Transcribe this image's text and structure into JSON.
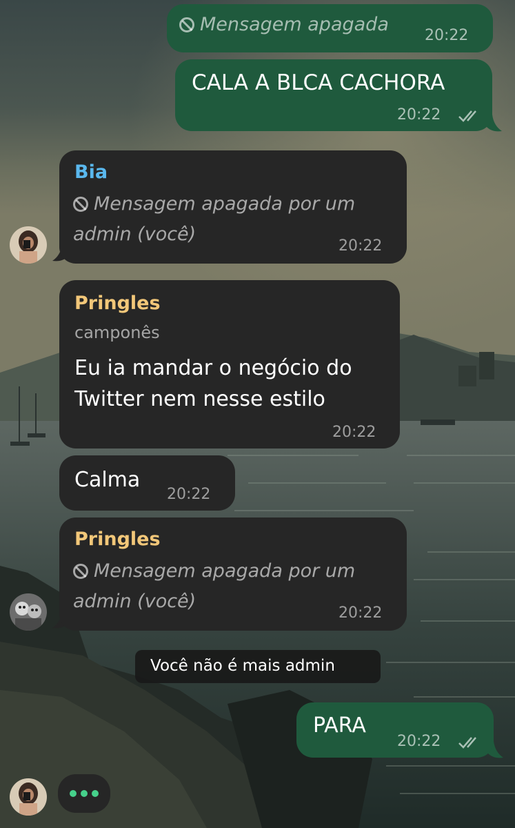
{
  "colors": {
    "outgoing_bubble": "#1f5a3d",
    "incoming_bubble": "#262626",
    "sender_bia": "#5ab8ee",
    "sender_pringles": "#f2c779",
    "typing_dots": "#46d18b"
  },
  "messages": {
    "m1": {
      "deleted_text": "Mensagem apagada",
      "time": "20:22"
    },
    "m2": {
      "text": "CALA A BLCA CACHORA",
      "time": "20:22"
    },
    "m3": {
      "sender": "Bia",
      "deleted_line1": "Mensagem apagada por um",
      "deleted_line2": "admin (você)",
      "time": "20:22"
    },
    "m4": {
      "sender": "Pringles",
      "sender_title": "camponês",
      "line1": "Eu ia mandar o negócio do",
      "line2": "Twitter nem nesse estilo",
      "time": "20:22"
    },
    "m5": {
      "text": "Calma",
      "time": "20:22"
    },
    "m6": {
      "sender": "Pringles",
      "deleted_line1": "Mensagem apagada por um",
      "deleted_line2": "admin (você)",
      "time": "20:22"
    },
    "m7": {
      "text": "PARA",
      "time": "20:22"
    }
  },
  "system": {
    "admin_notice": "Você não é mais admin"
  },
  "icons": {
    "deleted": "ban-icon",
    "read_receipt": "double-check-icon",
    "typing": "typing-dots-icon"
  }
}
